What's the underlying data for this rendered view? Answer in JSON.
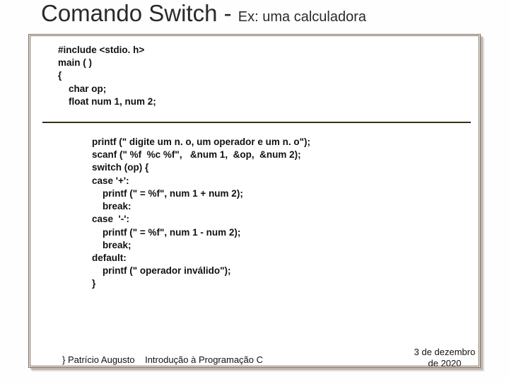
{
  "title": {
    "main": "Comando Switch - ",
    "sub": "Ex: uma calculadora"
  },
  "code": {
    "head": "#include <stdio. h>\nmain ( )\n{\n    char op;\n    float num 1, num 2;",
    "body": "printf (\" digite um n. o, um operador e um n. o\");\nscanf (\" %f  %c %f\",   &num 1,  &op,  &num 2);\nswitch (op) {\ncase '+':\n    printf (\" = %f\", num 1 + num 2);\n    break:\ncase  '-':\n    printf (\" = %f\", num 1 - num 2);\n    break;\ndefault:\n    printf (\" operador inválido\");\n}"
  },
  "footer": {
    "close_author": "}  Patrício Augusto",
    "course": "Introdução à Programação C"
  },
  "date": "3 de dezembro de 2020"
}
